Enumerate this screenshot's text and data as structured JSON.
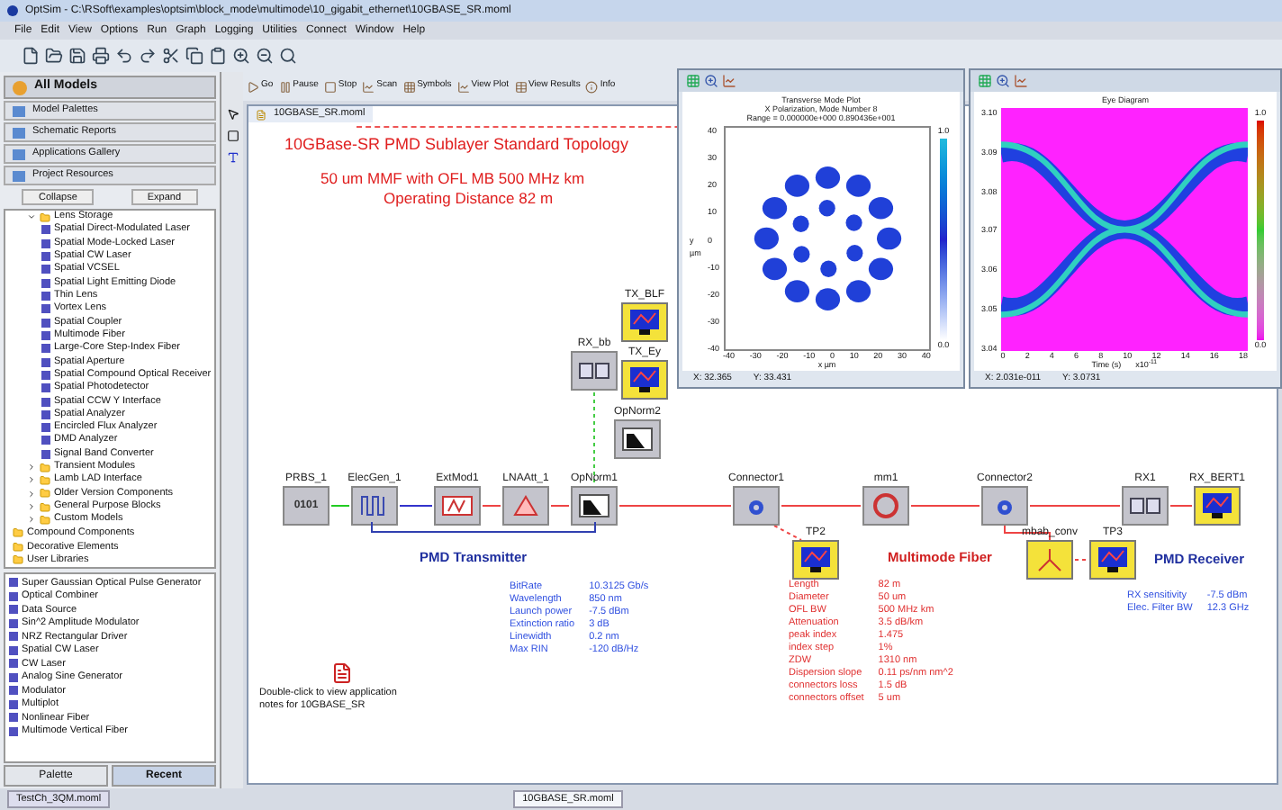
{
  "window": {
    "title": "OptSim - C:\\RSoft\\examples\\optsim\\block_mode\\multimode\\10_gigabit_ethernet\\10GBASE_SR.moml"
  },
  "menu": [
    "File",
    "Edit",
    "View",
    "Options",
    "Run",
    "Graph",
    "Logging",
    "Utilities",
    "Connect",
    "Window",
    "Help"
  ],
  "sidebar": {
    "header": "All Models",
    "sections": [
      "Model Palettes",
      "Schematic Reports",
      "Applications Gallery",
      "Project Resources"
    ],
    "collapse": "Collapse",
    "expand": "Expand",
    "tree": [
      {
        "label": "Lens Storage",
        "expanded": true,
        "children": [
          {
            "label": "Spatial Direct-Modulated Laser"
          },
          {
            "label": "Spatial Mode-Locked Laser"
          },
          {
            "label": "Spatial CW Laser"
          },
          {
            "label": "Spatial VCSEL"
          },
          {
            "label": "Spatial Light Emitting Diode"
          },
          {
            "label": "Thin Lens"
          },
          {
            "label": "Vortex Lens"
          },
          {
            "label": "Spatial Coupler"
          },
          {
            "label": "Multimode Fiber"
          },
          {
            "label": "Large-Core Step-Index Fiber"
          },
          {
            "label": "Spatial Aperture"
          },
          {
            "label": "Spatial Compound Optical Receiver"
          },
          {
            "label": "Spatial Photodetector"
          },
          {
            "label": "Spatial CCW Y Interface"
          },
          {
            "label": "Spatial Analyzer"
          },
          {
            "label": "Encircled Flux Analyzer"
          },
          {
            "label": "DMD Analyzer"
          },
          {
            "label": "Signal Band Converter"
          }
        ]
      },
      {
        "label": "Transient Modules",
        "expanded": false
      },
      {
        "label": "Lamb LAD Interface",
        "expanded": false
      },
      {
        "label": "Older Version Components",
        "expanded": false
      },
      {
        "label": "General Purpose Blocks",
        "expanded": false
      },
      {
        "label": "Custom Models",
        "expanded": false
      }
    ],
    "top_items": [
      "Compound Components",
      "Decorative Elements",
      "User Libraries"
    ],
    "recent": [
      "Super Gaussian Optical Pulse Generator",
      "Optical Combiner",
      "Data Source",
      "Sin^2 Amplitude Modulator",
      "NRZ Rectangular Driver",
      "Spatial CW Laser",
      "CW Laser",
      "Analog Sine Generator",
      "Modulator",
      "Multiplot",
      "Nonlinear Fiber",
      "Multimode Vertical Fiber"
    ],
    "bottom_tabs": [
      {
        "label": "Palette",
        "selected": false
      },
      {
        "label": "Recent",
        "selected": true
      }
    ]
  },
  "run_toolbar": [
    "Go",
    "Pause",
    "Stop",
    "Scan",
    "Symbols",
    "View Plot",
    "View Results",
    "Info"
  ],
  "document_tab": "10GBASE_SR.moml",
  "canvas": {
    "title": "10GBase-SR  PMD Sublayer Standard Topology",
    "subtitle": [
      "50 um MMF with OFL MB 500 MHz km",
      "Operating Distance 82 m"
    ],
    "nodes": [
      {
        "label": "PRBS_1",
        "kind": "prbs",
        "glyph": "0101"
      },
      {
        "label": "ElecGen_1",
        "kind": "elecgen"
      },
      {
        "label": "ExtMod1",
        "kind": "modulator"
      },
      {
        "label": "LNAAtt_1",
        "kind": "attenuator"
      },
      {
        "label": "OpNorm1",
        "kind": "normalizer"
      },
      {
        "label": "Connector1",
        "kind": "connector"
      },
      {
        "label": "mm1",
        "kind": "fiber"
      },
      {
        "label": "Connector2",
        "kind": "connector"
      },
      {
        "label": "RX1",
        "kind": "receiver"
      },
      {
        "label": "RX_BERT1",
        "kind": "scope"
      },
      {
        "label": "TP2",
        "kind": "scope"
      },
      {
        "label": "mbab_conv",
        "kind": "splitter"
      },
      {
        "label": "TP3",
        "kind": "scope"
      },
      {
        "label": "RX_bb",
        "kind": "receiver"
      },
      {
        "label": "TX_BLF",
        "kind": "scope"
      },
      {
        "label": "TX_Ey",
        "kind": "scope"
      },
      {
        "label": "OpNorm2",
        "kind": "normalizer"
      }
    ],
    "groups": [
      {
        "label": "PMD Transmitter",
        "color": "#1f2f9f"
      },
      {
        "label": "Multimode Fiber",
        "color": "#d01f1f"
      },
      {
        "label": "PMD Receiver",
        "color": "#1f2f9f"
      }
    ],
    "params": [
      {
        "color": "#3050e0",
        "rows": [
          [
            "BitRate",
            "10.3125 Gb/s"
          ],
          [
            "Wavelength",
            "850 nm"
          ],
          [
            "Launch power",
            "-7.5 dBm"
          ],
          [
            "Extinction ratio",
            "3 dB"
          ],
          [
            "Linewidth",
            "0.2 nm"
          ],
          [
            "Max RIN",
            "-120 dB/Hz"
          ]
        ]
      },
      {
        "color": "#e03030",
        "rows": [
          [
            "Length",
            "82 m"
          ],
          [
            "Diameter",
            "50 um"
          ],
          [
            "OFL BW",
            "500 MHz km"
          ],
          [
            "Attenuation",
            "3.5 dB/km"
          ],
          [
            "peak index",
            "1.475"
          ],
          [
            "index step",
            "1%"
          ],
          [
            "ZDW",
            "1310 nm"
          ],
          [
            "Dispersion slope",
            "0.11 ps/nm nm^2"
          ],
          [
            "connectors loss",
            "1.5 dB"
          ],
          [
            "connectors offset",
            "5 um"
          ]
        ]
      },
      {
        "color": "#3050e0",
        "rows": [
          [
            "RX sensitivity",
            "-7.5 dBm"
          ],
          [
            "Elec. Filter BW",
            "12.3 GHz"
          ]
        ]
      }
    ],
    "note": "Double-click to view application notes for 10GBASE_SR"
  },
  "plots": [
    {
      "kind": "mode",
      "title": [
        "Transverse Mode Plot",
        "X Polarization, Mode Number 8",
        "Range = 0.000000e+000 0.890436e+001"
      ],
      "xticks": [
        "-40",
        "-30",
        "-20",
        "-10",
        "0",
        "10",
        "20",
        "30",
        "40"
      ],
      "yticks": [
        "40",
        "30",
        "20",
        "10",
        "0",
        "-10",
        "-20",
        "-30",
        "-40"
      ],
      "xlabel": "x µm",
      "ylabel": "y µm",
      "cbar": [
        "1.0",
        "0.0"
      ],
      "status": [
        "X: 32.365",
        "Y: 33.431"
      ]
    },
    {
      "kind": "eye",
      "title": [
        "Eye Diagram"
      ],
      "xticks": [
        "0",
        "2",
        "4",
        "6",
        "8",
        "10",
        "12",
        "14",
        "16",
        "18"
      ],
      "yticks": [
        "3.10",
        "3.09",
        "3.08",
        "3.07",
        "3.06",
        "3.05",
        "3.04"
      ],
      "xlabel": "Time (s)",
      "xscale": "x10$^{-11}$",
      "cbar": [
        "1.0",
        "0.0"
      ],
      "status": [
        "X: 2.031e-011",
        "Y: 3.0731"
      ]
    }
  ],
  "status_tabs": [
    {
      "label": "TestCh_3QM.moml",
      "selected": false
    },
    {
      "label": "10GBASE_SR.moml",
      "selected": true
    }
  ]
}
